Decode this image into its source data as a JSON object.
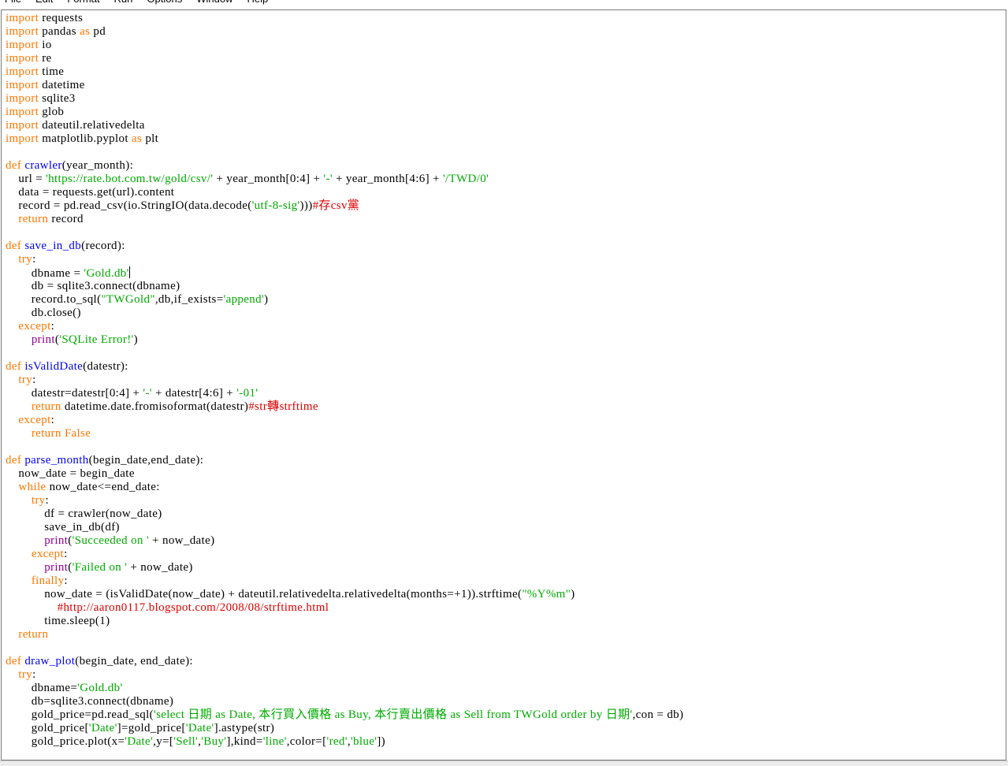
{
  "menu": [
    "File",
    "Edit",
    "Format",
    "Run",
    "Options",
    "Window",
    "Help"
  ],
  "colors": {
    "keyword": "#ff7700",
    "definition": "#0000ff",
    "string": "#00aa00",
    "comment": "#dd0000",
    "builtin": "#900090",
    "text": "#000000",
    "background": "#ffffff"
  },
  "cursor": {
    "line": 19,
    "after_token": 1
  },
  "code_lines": [
    [
      {
        "t": "kw",
        "v": "import"
      },
      {
        "t": "n",
        "v": " requests"
      }
    ],
    [
      {
        "t": "kw",
        "v": "import"
      },
      {
        "t": "n",
        "v": " pandas "
      },
      {
        "t": "kw",
        "v": "as"
      },
      {
        "t": "n",
        "v": " pd"
      }
    ],
    [
      {
        "t": "kw",
        "v": "import"
      },
      {
        "t": "n",
        "v": " io"
      }
    ],
    [
      {
        "t": "kw",
        "v": "import"
      },
      {
        "t": "n",
        "v": " re"
      }
    ],
    [
      {
        "t": "kw",
        "v": "import"
      },
      {
        "t": "n",
        "v": " time"
      }
    ],
    [
      {
        "t": "kw",
        "v": "import"
      },
      {
        "t": "n",
        "v": " datetime"
      }
    ],
    [
      {
        "t": "kw",
        "v": "import"
      },
      {
        "t": "n",
        "v": " sqlite3"
      }
    ],
    [
      {
        "t": "kw",
        "v": "import"
      },
      {
        "t": "n",
        "v": " glob"
      }
    ],
    [
      {
        "t": "kw",
        "v": "import"
      },
      {
        "t": "n",
        "v": " dateutil.relativedelta"
      }
    ],
    [
      {
        "t": "kw",
        "v": "import"
      },
      {
        "t": "n",
        "v": " matplotlib.pyplot "
      },
      {
        "t": "kw",
        "v": "as"
      },
      {
        "t": "n",
        "v": " plt"
      }
    ],
    [],
    [
      {
        "t": "kw",
        "v": "def"
      },
      {
        "t": "n",
        "v": " "
      },
      {
        "t": "def",
        "v": "crawler"
      },
      {
        "t": "n",
        "v": "(year_month):"
      }
    ],
    [
      {
        "t": "n",
        "v": "    url = "
      },
      {
        "t": "str",
        "v": "'https://rate.bot.com.tw/gold/csv/'"
      },
      {
        "t": "n",
        "v": " + year_month[0:4] + "
      },
      {
        "t": "str",
        "v": "'-'"
      },
      {
        "t": "n",
        "v": " + year_month[4:6] + "
      },
      {
        "t": "str",
        "v": "'/TWD/0'"
      }
    ],
    [
      {
        "t": "n",
        "v": "    data = requests.get(url).content"
      }
    ],
    [
      {
        "t": "n",
        "v": "    record = pd.read_csv(io.StringIO(data.decode("
      },
      {
        "t": "str",
        "v": "'utf-8-sig'"
      },
      {
        "t": "n",
        "v": ")))"
      },
      {
        "t": "com",
        "v": "#存csv黨"
      }
    ],
    [
      {
        "t": "n",
        "v": "    "
      },
      {
        "t": "kw",
        "v": "return"
      },
      {
        "t": "n",
        "v": " record"
      }
    ],
    [],
    [
      {
        "t": "kw",
        "v": "def"
      },
      {
        "t": "n",
        "v": " "
      },
      {
        "t": "def",
        "v": "save_in_db"
      },
      {
        "t": "n",
        "v": "(record):"
      }
    ],
    [
      {
        "t": "n",
        "v": "    "
      },
      {
        "t": "kw",
        "v": "try"
      },
      {
        "t": "n",
        "v": ":"
      }
    ],
    [
      {
        "t": "n",
        "v": "        dbname = "
      },
      {
        "t": "str",
        "v": "'Gold.db'"
      }
    ],
    [
      {
        "t": "n",
        "v": "        db = sqlite3.connect(dbname)"
      }
    ],
    [
      {
        "t": "n",
        "v": "        record.to_sql("
      },
      {
        "t": "str",
        "v": "\"TWGold\""
      },
      {
        "t": "n",
        "v": ",db,if_exists="
      },
      {
        "t": "str",
        "v": "'append'"
      },
      {
        "t": "n",
        "v": ")"
      }
    ],
    [
      {
        "t": "n",
        "v": "        db.close()"
      }
    ],
    [
      {
        "t": "n",
        "v": "    "
      },
      {
        "t": "kw",
        "v": "except"
      },
      {
        "t": "n",
        "v": ":"
      }
    ],
    [
      {
        "t": "n",
        "v": "        "
      },
      {
        "t": "bi",
        "v": "print"
      },
      {
        "t": "n",
        "v": "("
      },
      {
        "t": "str",
        "v": "'SQLite Error!'"
      },
      {
        "t": "n",
        "v": ")"
      }
    ],
    [],
    [
      {
        "t": "kw",
        "v": "def"
      },
      {
        "t": "n",
        "v": " "
      },
      {
        "t": "def",
        "v": "isValidDate"
      },
      {
        "t": "n",
        "v": "(datestr):"
      }
    ],
    [
      {
        "t": "n",
        "v": "    "
      },
      {
        "t": "kw",
        "v": "try"
      },
      {
        "t": "n",
        "v": ":"
      }
    ],
    [
      {
        "t": "n",
        "v": "        datestr=datestr[0:4] + "
      },
      {
        "t": "str",
        "v": "'-'"
      },
      {
        "t": "n",
        "v": " + datestr[4:6] + "
      },
      {
        "t": "str",
        "v": "'-01'"
      }
    ],
    [
      {
        "t": "n",
        "v": "        "
      },
      {
        "t": "kw",
        "v": "return"
      },
      {
        "t": "n",
        "v": " datetime.date.fromisoformat(datestr)"
      },
      {
        "t": "com",
        "v": "#str轉strftime"
      }
    ],
    [
      {
        "t": "n",
        "v": "    "
      },
      {
        "t": "kw",
        "v": "except"
      },
      {
        "t": "n",
        "v": ":"
      }
    ],
    [
      {
        "t": "n",
        "v": "        "
      },
      {
        "t": "kw",
        "v": "return"
      },
      {
        "t": "n",
        "v": " "
      },
      {
        "t": "kw",
        "v": "False"
      }
    ],
    [],
    [
      {
        "t": "kw",
        "v": "def"
      },
      {
        "t": "n",
        "v": " "
      },
      {
        "t": "def",
        "v": "parse_month"
      },
      {
        "t": "n",
        "v": "(begin_date,end_date):"
      }
    ],
    [
      {
        "t": "n",
        "v": "    now_date = begin_date"
      }
    ],
    [
      {
        "t": "n",
        "v": "    "
      },
      {
        "t": "kw",
        "v": "while"
      },
      {
        "t": "n",
        "v": " now_date<=end_date:"
      }
    ],
    [
      {
        "t": "n",
        "v": "        "
      },
      {
        "t": "kw",
        "v": "try"
      },
      {
        "t": "n",
        "v": ":"
      }
    ],
    [
      {
        "t": "n",
        "v": "            df = crawler(now_date)"
      }
    ],
    [
      {
        "t": "n",
        "v": "            save_in_db(df)"
      }
    ],
    [
      {
        "t": "n",
        "v": "            "
      },
      {
        "t": "bi",
        "v": "print"
      },
      {
        "t": "n",
        "v": "("
      },
      {
        "t": "str",
        "v": "'Succeeded on '"
      },
      {
        "t": "n",
        "v": " + now_date)"
      }
    ],
    [
      {
        "t": "n",
        "v": "        "
      },
      {
        "t": "kw",
        "v": "except"
      },
      {
        "t": "n",
        "v": ":"
      }
    ],
    [
      {
        "t": "n",
        "v": "            "
      },
      {
        "t": "bi",
        "v": "print"
      },
      {
        "t": "n",
        "v": "("
      },
      {
        "t": "str",
        "v": "'Failed on '"
      },
      {
        "t": "n",
        "v": " + now_date)"
      }
    ],
    [
      {
        "t": "n",
        "v": "        "
      },
      {
        "t": "kw",
        "v": "finally"
      },
      {
        "t": "n",
        "v": ":"
      }
    ],
    [
      {
        "t": "n",
        "v": "            now_date = (isValidDate(now_date) + dateutil.relativedelta.relativedelta(months=+1)).strftime("
      },
      {
        "t": "str",
        "v": "\"%Y%m\""
      },
      {
        "t": "n",
        "v": ")"
      }
    ],
    [
      {
        "t": "n",
        "v": "                "
      },
      {
        "t": "com",
        "v": "#http://aaron0117.blogspot.com/2008/08/strftime.html"
      }
    ],
    [
      {
        "t": "n",
        "v": "            time.sleep(1)"
      }
    ],
    [
      {
        "t": "n",
        "v": "    "
      },
      {
        "t": "kw",
        "v": "return"
      }
    ],
    [],
    [
      {
        "t": "kw",
        "v": "def"
      },
      {
        "t": "n",
        "v": " "
      },
      {
        "t": "def",
        "v": "draw_plot"
      },
      {
        "t": "n",
        "v": "(begin_date, end_date):"
      }
    ],
    [
      {
        "t": "n",
        "v": "    "
      },
      {
        "t": "kw",
        "v": "try"
      },
      {
        "t": "n",
        "v": ":"
      }
    ],
    [
      {
        "t": "n",
        "v": "        dbname="
      },
      {
        "t": "str",
        "v": "'Gold.db'"
      }
    ],
    [
      {
        "t": "n",
        "v": "        db=sqlite3.connect(dbname)"
      }
    ],
    [
      {
        "t": "n",
        "v": "        gold_price=pd.read_sql("
      },
      {
        "t": "str",
        "v": "'select 日期 as Date, 本行買入價格 as Buy, 本行賣出價格 as Sell from TWGold order by 日期'"
      },
      {
        "t": "n",
        "v": ",con = db)"
      }
    ],
    [
      {
        "t": "n",
        "v": "        gold_price["
      },
      {
        "t": "str",
        "v": "'Date'"
      },
      {
        "t": "n",
        "v": "]=gold_price["
      },
      {
        "t": "str",
        "v": "'Date'"
      },
      {
        "t": "n",
        "v": "].astype(str)"
      }
    ],
    [
      {
        "t": "n",
        "v": "        gold_price.plot(x="
      },
      {
        "t": "str",
        "v": "'Date'"
      },
      {
        "t": "n",
        "v": ",y=["
      },
      {
        "t": "str",
        "v": "'Sell'"
      },
      {
        "t": "n",
        "v": ","
      },
      {
        "t": "str",
        "v": "'Buy'"
      },
      {
        "t": "n",
        "v": "],kind="
      },
      {
        "t": "str",
        "v": "'line'"
      },
      {
        "t": "n",
        "v": ",color=["
      },
      {
        "t": "str",
        "v": "'red'"
      },
      {
        "t": "n",
        "v": ","
      },
      {
        "t": "str",
        "v": "'blue'"
      },
      {
        "t": "n",
        "v": "])"
      }
    ]
  ]
}
